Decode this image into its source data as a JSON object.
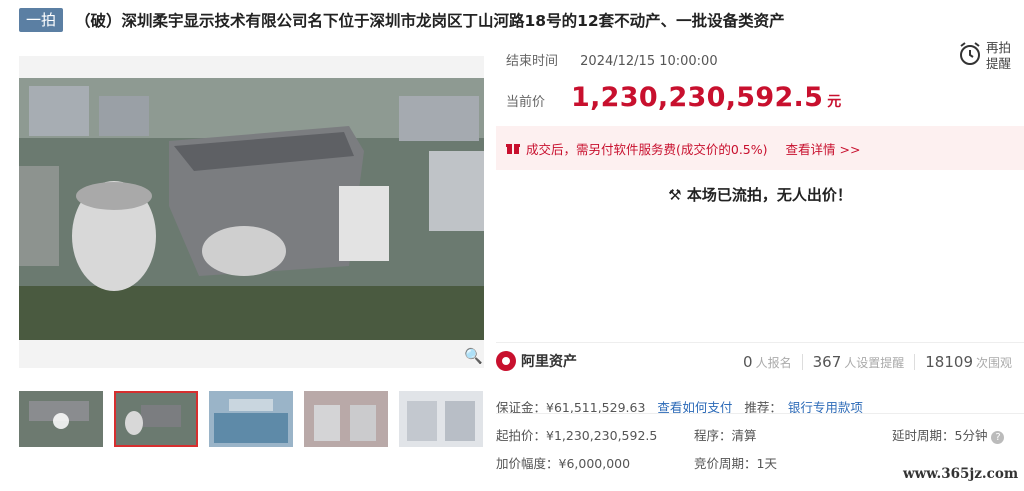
{
  "header": {
    "badge": "一拍",
    "title": "（破）深圳柔宇显示技术有限公司名下位于深圳市龙岗区丁山河路18号的12套不动产、一批设备类资产"
  },
  "auction": {
    "end_label": "结束时间",
    "end_time": "2024/12/15 10:00:00",
    "remind_label_1": "再拍",
    "remind_label_2": "提醒",
    "price_label": "当前价",
    "price": "1,230,230,592.5",
    "price_unit": "元",
    "notice_text": "成交后，需另付软件服务费(成交价的0.5%)",
    "notice_link": "查看详情 >>",
    "flow_text": "本场已流拍，无人出价！"
  },
  "platform": {
    "name": "阿里资产",
    "signups": "0",
    "signups_label": "人报名",
    "reminders": "367",
    "reminders_label": "人设置提醒",
    "views": "18109",
    "views_label": "次围观"
  },
  "details": {
    "deposit_label": "保证金：",
    "deposit": "¥61,511,529.63",
    "pay_link": "查看如何支付",
    "recommend_label": "推荐：",
    "recommend_link": "银行专用款项",
    "start_label": "起拍价：",
    "start": "¥1,230,230,592.5",
    "procedure_label": "程序：",
    "procedure": "清算",
    "delay_label": "延时周期：",
    "delay": "5分钟",
    "increment_label": "加价幅度：",
    "increment": "¥6,000,000",
    "bid_period_label": "竞价周期：",
    "bid_period": "1天"
  },
  "watermark": "www.365jz.com",
  "colors": {
    "accent": "#c8102e",
    "badge": "#5b7fa3",
    "link": "#2d6bb8"
  }
}
